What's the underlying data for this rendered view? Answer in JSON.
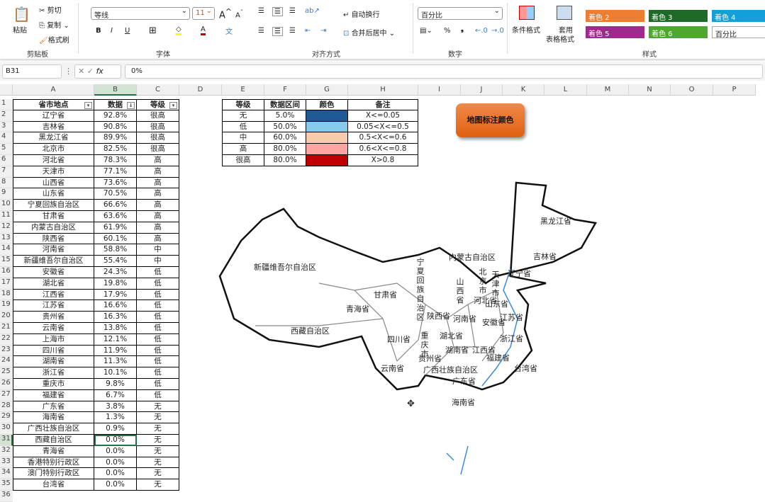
{
  "ribbon": {
    "clipboard": {
      "paste": "粘贴",
      "cut": "剪切",
      "copy": "复制",
      "format_painter": "格式刷",
      "label": "剪贴板"
    },
    "font": {
      "name": "等线",
      "size": "11",
      "bold": "B",
      "italic": "I",
      "underline": "U",
      "label": "字体"
    },
    "alignment": {
      "wrap": "自动换行",
      "merge": "合并后居中",
      "label": "对齐方式"
    },
    "number": {
      "format": "百分比",
      "percent": "%",
      "comma": "❟",
      "label": "数字"
    },
    "styles": {
      "conditional": "条件格式",
      "table_format_1": "套用",
      "table_format_2": "表格格式",
      "label": "样式",
      "tiles": [
        {
          "label": "着色 2",
          "color": "#ED7D31"
        },
        {
          "label": "着色 3",
          "color": "#1E6B27"
        },
        {
          "label": "着色 4",
          "color": "#159FD8"
        },
        {
          "label": "着色 5",
          "color": "#9E2A8E"
        },
        {
          "label": "着色 6",
          "color": "#4EA72E"
        },
        {
          "label": "百分比",
          "color": "#ffffff"
        }
      ]
    }
  },
  "formula_bar": {
    "name_box": "B31",
    "fx": "fx",
    "value": "0%"
  },
  "columns": [
    "A",
    "B",
    "C",
    "D",
    "E",
    "F",
    "G",
    "H",
    "I",
    "J",
    "K",
    "L",
    "M",
    "N",
    "O",
    "P"
  ],
  "table": {
    "headers": [
      "省市地点",
      "数据",
      "等级"
    ],
    "rows": [
      [
        "辽宁省",
        "92.8%",
        "很高"
      ],
      [
        "吉林省",
        "90.8%",
        "很高"
      ],
      [
        "黑龙江省",
        "89.9%",
        "很高"
      ],
      [
        "北京市",
        "82.5%",
        "很高"
      ],
      [
        "河北省",
        "78.3%",
        "高"
      ],
      [
        "天津市",
        "77.1%",
        "高"
      ],
      [
        "山西省",
        "73.6%",
        "高"
      ],
      [
        "山东省",
        "70.5%",
        "高"
      ],
      [
        "宁夏回族自治区",
        "66.6%",
        "高"
      ],
      [
        "甘肃省",
        "63.6%",
        "高"
      ],
      [
        "内蒙古自治区",
        "61.9%",
        "高"
      ],
      [
        "陕西省",
        "60.1%",
        "高"
      ],
      [
        "河南省",
        "58.8%",
        "中"
      ],
      [
        "新疆维吾尔自治区",
        "55.4%",
        "中"
      ],
      [
        "安徽省",
        "24.3%",
        "低"
      ],
      [
        "湖北省",
        "19.8%",
        "低"
      ],
      [
        "江西省",
        "17.9%",
        "低"
      ],
      [
        "江苏省",
        "16.6%",
        "低"
      ],
      [
        "贵州省",
        "16.3%",
        "低"
      ],
      [
        "云南省",
        "13.8%",
        "低"
      ],
      [
        "上海市",
        "12.1%",
        "低"
      ],
      [
        "四川省",
        "11.9%",
        "低"
      ],
      [
        "湖南省",
        "11.3%",
        "低"
      ],
      [
        "浙江省",
        "10.1%",
        "低"
      ],
      [
        "重庆市",
        "9.8%",
        "低"
      ],
      [
        "福建省",
        "6.7%",
        "低"
      ],
      [
        "广东省",
        "3.8%",
        "无"
      ],
      [
        "海南省",
        "1.3%",
        "无"
      ],
      [
        "广西壮族自治区",
        "0.9%",
        "无"
      ],
      [
        "西藏自治区",
        "0.0%",
        "无"
      ],
      [
        "青海省",
        "0.0%",
        "无"
      ],
      [
        "香港特别行政区",
        "0.0%",
        "无"
      ],
      [
        "澳门特别行政区",
        "0.0%",
        "无"
      ],
      [
        "台湾省",
        "0.0%",
        "无"
      ]
    ]
  },
  "legend": {
    "headers": [
      "等级",
      "数据区间",
      "颜色",
      "备注"
    ],
    "rows": [
      {
        "level": "无",
        "range": "5.0%",
        "color": "#1F5A96",
        "note": "X<=0.05"
      },
      {
        "level": "低",
        "range": "50.0%",
        "color": "#86C9EA",
        "note": "0.05<X<=0.5"
      },
      {
        "level": "中",
        "range": "60.0%",
        "color": "#F8CBAD",
        "note": "0.5<X<=0.6"
      },
      {
        "level": "高",
        "range": "80.0%",
        "color": "#FFA3A3",
        "note": "0.6<X<=0.8"
      },
      {
        "level": "很高",
        "range": "80.0%",
        "color": "#C00000",
        "note": "X>0.8"
      }
    ]
  },
  "map_button": "地图标注颜色",
  "map_labels": [
    "黑龙江省",
    "吉林省",
    "辽宁省",
    "内蒙古自治区",
    "新疆维吾尔自治区",
    "宁夏回族自治区",
    "甘肃省",
    "青海省",
    "西藏自治区",
    "四川省",
    "陕西省",
    "山西省",
    "河北省",
    "北京市",
    "天津市",
    "山东省",
    "河南省",
    "江苏省",
    "安徽省",
    "湖北省",
    "重庆市",
    "浙江省",
    "湖南省",
    "江西省",
    "贵州省",
    "云南省",
    "广西壮族自治区",
    "广东省",
    "福建省",
    "台湾省",
    "海南省"
  ]
}
